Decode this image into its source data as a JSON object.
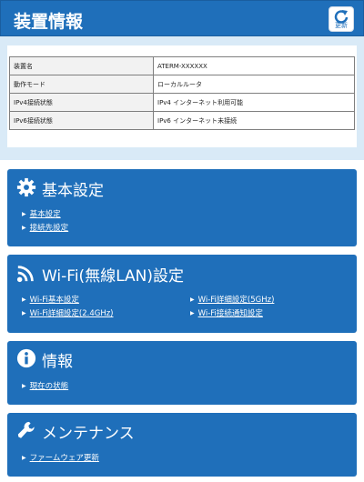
{
  "header": {
    "title": "装置情報",
    "refresh_label": "更新"
  },
  "device_info": {
    "rows": [
      {
        "key": "装置名",
        "value": "ATERM-XXXXXX"
      },
      {
        "key": "動作モード",
        "value": "ローカルルータ"
      },
      {
        "key": "IPv4接続状態",
        "value": "IPv4 インターネット利用可能"
      },
      {
        "key": "IPv6接続状態",
        "value": "IPv6 インターネット未接続"
      }
    ]
  },
  "sections": {
    "basic": {
      "title": "基本設定",
      "icon": "gear-icon",
      "links": [
        "基本設定",
        "接続先設定"
      ]
    },
    "wifi": {
      "title": "Wi-Fi(無線LAN)設定",
      "icon": "wifi-icon",
      "links": [
        "Wi-Fi基本設定",
        "Wi-Fi詳細設定(2.4GHz)",
        "Wi-Fi詳細設定(5GHz)",
        "Wi-Fi接続通知設定"
      ]
    },
    "info": {
      "title": "情報",
      "icon": "info-icon",
      "links": [
        "現在の状態"
      ]
    },
    "maintenance": {
      "title": "メンテナンス",
      "icon": "wrench-icon",
      "links": [
        "ファームウェア更新"
      ]
    }
  },
  "colors": {
    "accent": "#1f6fba",
    "info_bg": "#d9eaf7"
  }
}
